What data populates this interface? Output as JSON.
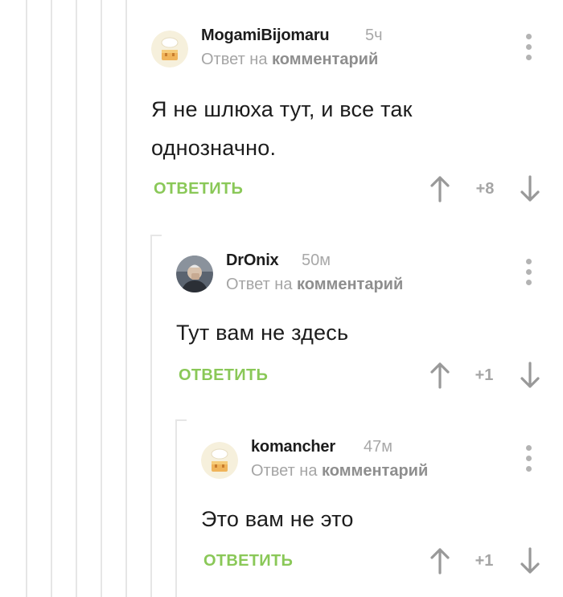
{
  "comments": [
    {
      "author": "MogamiBijomaru",
      "time": "5ч",
      "reply_prefix": "Ответ на ",
      "reply_link": "комментарий",
      "text_lines": [
        "Я не шлюха тут, и все так",
        "однозначно."
      ],
      "reply_label": "ОТВЕТИТЬ",
      "score": "+8",
      "avatar": "default-cake-avatar"
    },
    {
      "author": "DrOnix",
      "time": "50м",
      "reply_prefix": "Ответ на ",
      "reply_link": "комментарий",
      "text_lines": [
        "Тут вам не здесь"
      ],
      "reply_label": "ОТВЕТИТЬ",
      "score": "+1",
      "avatar": "photo-avatar"
    },
    {
      "author": "komancher",
      "time": "47м",
      "reply_prefix": "Ответ на ",
      "reply_link": "комментарий",
      "text_lines": [
        "Это вам не это"
      ],
      "reply_label": "ОТВЕТИТЬ",
      "score": "+1",
      "avatar": "default-cake-avatar"
    }
  ],
  "colors": {
    "accent_green": "#8ac858",
    "thread_line": "#e6e6e6",
    "muted_text": "#a5a5a5"
  }
}
